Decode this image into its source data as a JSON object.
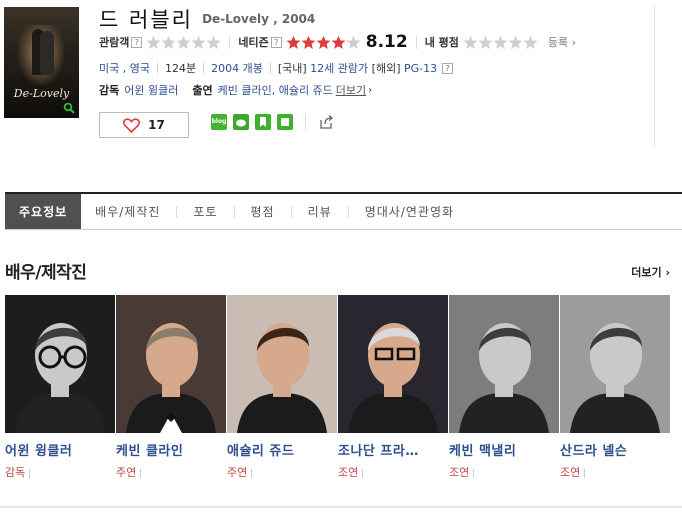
{
  "movie": {
    "title_ko": "드 러블리",
    "title_en": "De-Lovely , 2004",
    "poster_title": "De-Lovely"
  },
  "ratings": {
    "audience_label": "관람객",
    "netizen_label": "네티즌",
    "netizen_score": "8.12",
    "netizen_star_fraction": 0.81,
    "my_rating_label": "내 평점",
    "register_label": "등록",
    "help_glyph": "?"
  },
  "meta": {
    "country": "미국 , 영국",
    "runtime": "124분",
    "release": "2004 개봉",
    "domestic_tag": "[국내]",
    "domestic_rating": "12세 관람가",
    "overseas_tag": "[해외]",
    "overseas_rating": "PG-13"
  },
  "credits": {
    "director_label": "감독",
    "director": "어윈 윙클러",
    "cast_label": "출연",
    "cast": "케빈 클라인, 애슐리 쥬드",
    "more_label": "더보기"
  },
  "like": {
    "count": "17"
  },
  "share_icons": [
    "blog-icon",
    "me2day-icon",
    "bookmark-icon",
    "green-square-icon",
    "share-out-icon"
  ],
  "tabs": [
    {
      "label": "주요정보",
      "active": true
    },
    {
      "label": "배우/제작진",
      "active": false
    },
    {
      "label": "포토",
      "active": false
    },
    {
      "label": "평점",
      "active": false
    },
    {
      "label": "리뷰",
      "active": false
    },
    {
      "label": "명대사/연관영화",
      "active": false
    }
  ],
  "cast_section": {
    "title": "배우/제작진",
    "more_label": "더보기 ›",
    "people": [
      {
        "name": "어윈 윙클러",
        "role": "감독",
        "photo": "bw"
      },
      {
        "name": "케빈 클라인",
        "role": "주연",
        "photo": "color"
      },
      {
        "name": "애슐리 쥬드",
        "role": "주연",
        "photo": "color"
      },
      {
        "name": "조나단 프라…",
        "role": "조연",
        "photo": "color"
      },
      {
        "name": "케빈 맥낼리",
        "role": "조연",
        "photo": "bw"
      },
      {
        "name": "산드라 넬슨",
        "role": "조연",
        "photo": "bw"
      }
    ]
  },
  "colors": {
    "link_blue": "#2d4f8e",
    "star_red": "#e03c3c",
    "star_gray": "#cfcfcf",
    "role_red": "#c04545",
    "tab_active_bg": "#505050"
  }
}
